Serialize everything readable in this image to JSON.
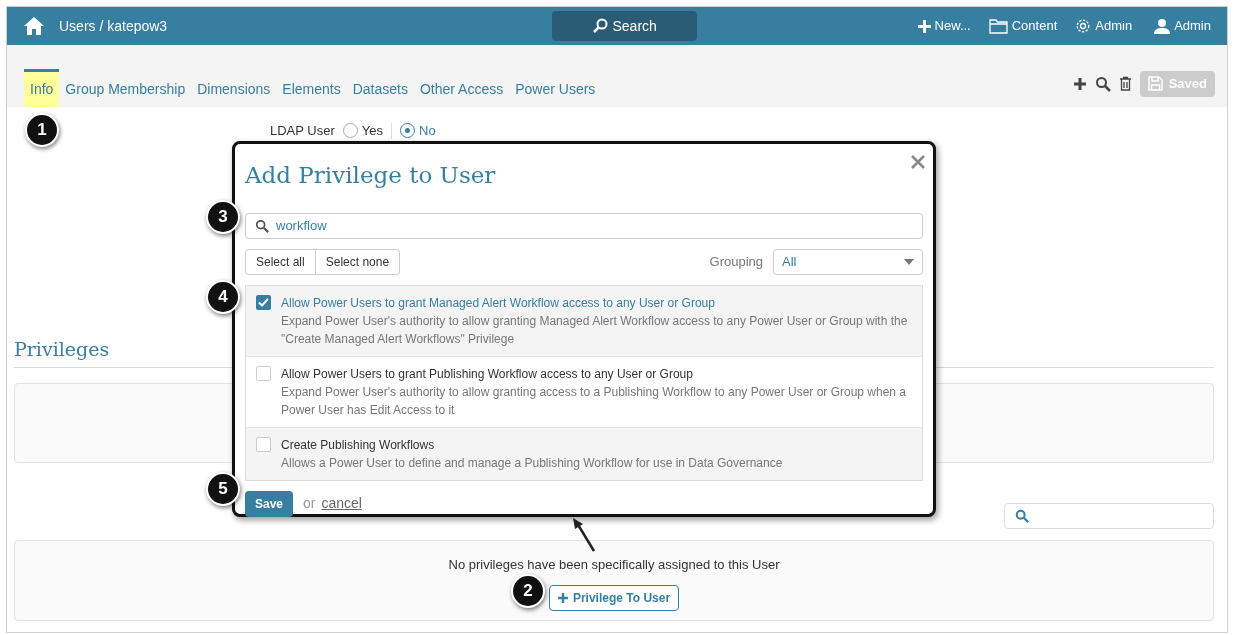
{
  "topbar": {
    "breadcrumb": "Users / katepow3",
    "search_label": "Search",
    "nav": [
      {
        "kind": "new",
        "label": "New..."
      },
      {
        "kind": "content",
        "label": "Content"
      },
      {
        "kind": "admin",
        "label": "Admin"
      },
      {
        "kind": "user",
        "label": "Admin"
      }
    ]
  },
  "tabs": [
    {
      "label": "Info",
      "selected": true
    },
    {
      "label": "Group Membership",
      "selected": false
    },
    {
      "label": "Dimensions",
      "selected": false
    },
    {
      "label": "Elements",
      "selected": false
    },
    {
      "label": "Datasets",
      "selected": false
    },
    {
      "label": "Other Access",
      "selected": false
    },
    {
      "label": "Power Users",
      "selected": false
    }
  ],
  "toolbar": {
    "save_label": "Saved",
    "disabled": true
  },
  "ldap": {
    "label": "LDAP User",
    "options": [
      {
        "label": "Yes",
        "selected": false
      },
      {
        "label": "No",
        "selected": true
      }
    ]
  },
  "privileges": {
    "heading": "Privileges",
    "empty_message": "No privileges have been specifically assigned to this User",
    "add_button": "Privilege To User"
  },
  "modal": {
    "title": "Add Privilege to User",
    "search_value": "workflow",
    "select_all": "Select all",
    "select_none": "Select none",
    "grouping_label": "Grouping",
    "grouping_value": "All",
    "items": [
      {
        "title": "Allow Power Users to grant Managed Alert Workflow access to any User or Group",
        "description": "Expand Power User's authority to allow granting Managed Alert Workflow access to any Power User or Group with the \"Create Managed Alert Workflows\" Privilege",
        "checked": true
      },
      {
        "title": "Allow Power Users to grant Publishing Workflow access to any User or Group",
        "description": "Expand Power User's authority to allow granting access to a Publishing Workflow to any Power User or Group when a Power User has Edit Access to it",
        "checked": false
      },
      {
        "title": "Create Publishing Workflows",
        "description": "Allows a Power User to define and manage a Publishing Workflow for use in Data Governance",
        "checked": false
      }
    ],
    "save": "Save",
    "or": "or",
    "cancel": "cancel"
  },
  "callouts": [
    "1",
    "2",
    "3",
    "4",
    "5"
  ]
}
